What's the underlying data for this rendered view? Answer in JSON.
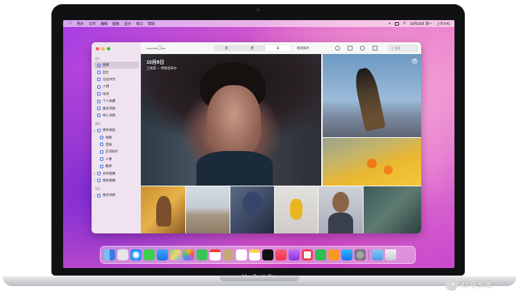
{
  "menubar": {
    "items": [
      "照片",
      "文件",
      "编辑",
      "图像",
      "显示",
      "窗口",
      "帮助"
    ],
    "clock": "10月18日 周一",
    "time": "上午9:41"
  },
  "sidebar": {
    "section_photos": "照片",
    "items": [
      {
        "label": "图库",
        "active": true
      },
      {
        "label": "回忆"
      },
      {
        "label": "与您共享"
      },
      {
        "label": "人物"
      },
      {
        "label": "地点"
      },
      {
        "label": "个人收藏"
      },
      {
        "label": "最近项目"
      },
      {
        "label": "导入项目"
      }
    ],
    "section_media": "媒体",
    "media_items": [
      {
        "label": "媒体类型",
        "chevron": "v"
      },
      {
        "label": "视频",
        "sub": true
      },
      {
        "label": "自拍",
        "sub": true
      },
      {
        "label": "实况照片",
        "sub": true
      },
      {
        "label": "人像",
        "sub": true
      },
      {
        "label": "截屏",
        "sub": true
      },
      {
        "label": "共享相簿",
        "chevron": ">"
      },
      {
        "label": "我的相簿",
        "chevron": ">"
      }
    ],
    "section_projects": "项目",
    "project_items": [
      {
        "label": "我的项目",
        "chevron": ">"
      }
    ]
  },
  "toolbar": {
    "segments": [
      "年",
      "月",
      "日"
    ],
    "active_segment": 2,
    "view_label": "所有照片",
    "search_placeholder": "搜索"
  },
  "photo": {
    "date": "10月9日",
    "place": "土耳其 — 伊斯坦布尔",
    "more": "•••"
  },
  "device": {
    "model": "MacBook Pro"
  },
  "watermark": {
    "text": "42号车库"
  },
  "dock": {
    "icons": [
      "finder-icon",
      "launchpad-icon",
      "safari-icon",
      "messages-icon",
      "mail-icon",
      "maps-icon",
      "photos-icon",
      "facetime-icon",
      "calendar-icon",
      "contacts-icon",
      "reminders-icon",
      "notes-icon",
      "appletv-icon",
      "music-icon",
      "podcasts-icon",
      "news-icon",
      "numbers-icon",
      "pages-icon",
      "appstore-icon",
      "settings-icon",
      "downloads-icon",
      "trash-icon"
    ]
  }
}
